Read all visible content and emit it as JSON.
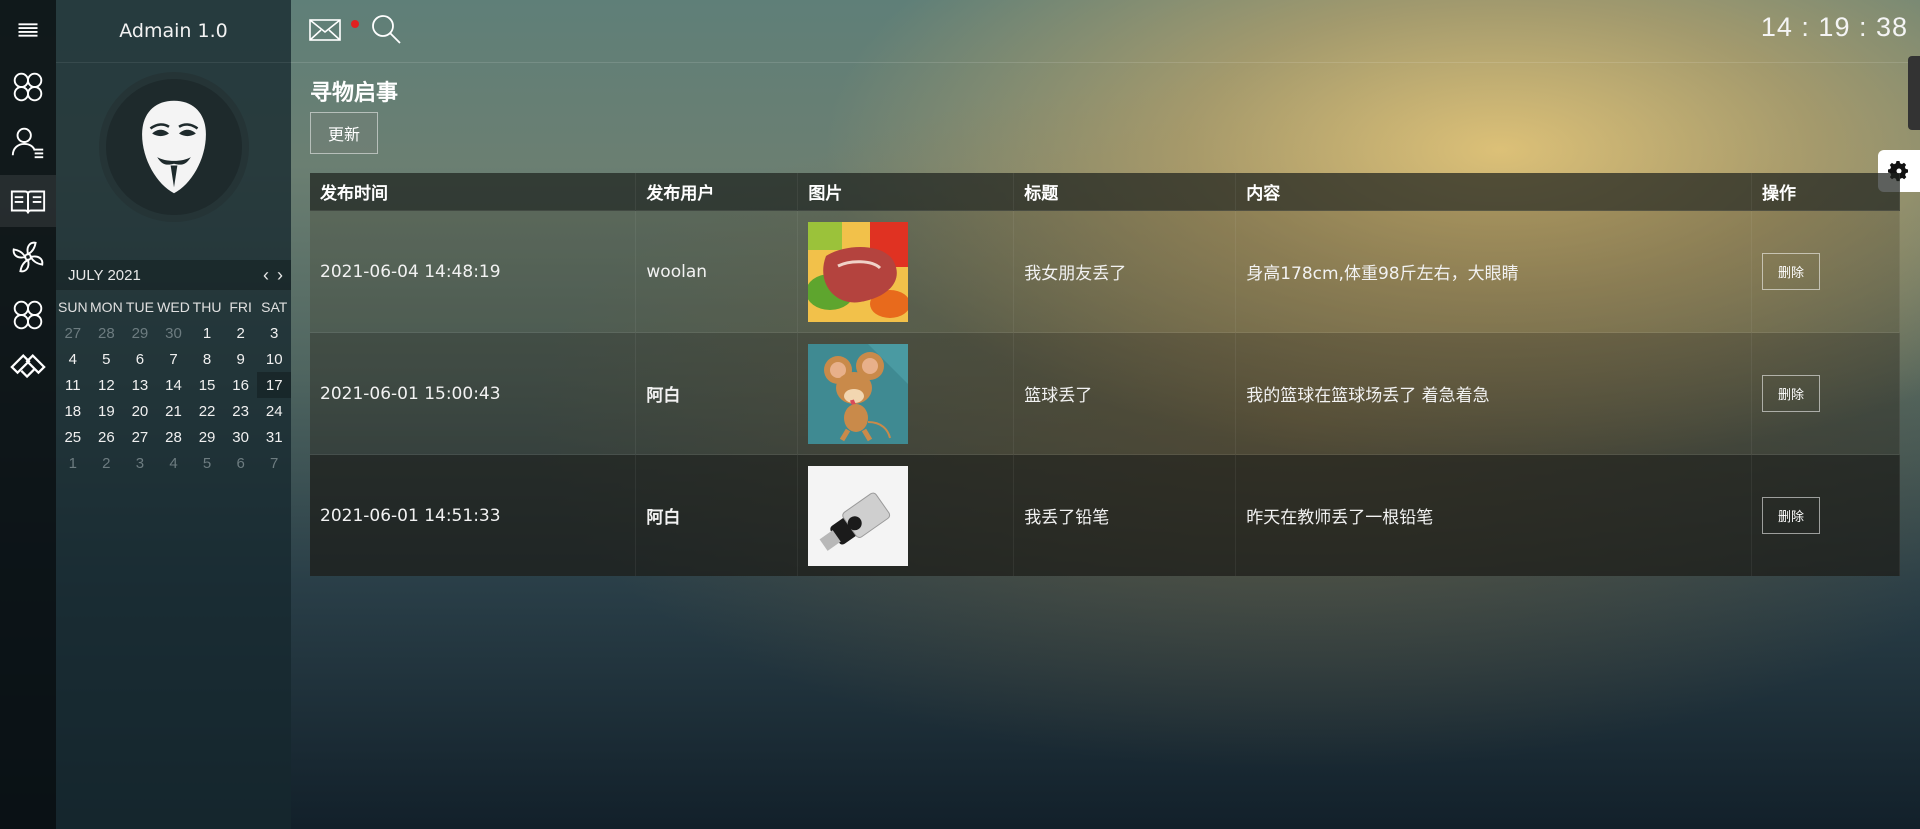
{
  "app": {
    "title": "Admain 1.0",
    "clock": "14 : 19 : 38"
  },
  "iconbar": {
    "items": [
      {
        "icon": "menu-icon"
      },
      {
        "icon": "grid-icon"
      },
      {
        "icon": "user-list-icon"
      },
      {
        "icon": "book-icon",
        "active": true
      },
      {
        "icon": "fan-icon"
      },
      {
        "icon": "grid-icon"
      },
      {
        "icon": "handshake-icon"
      }
    ]
  },
  "topbar": {
    "icons": [
      "mail-icon",
      "search-icon"
    ],
    "mail_has_notification": true
  },
  "calendar": {
    "month_label": "JULY 2021",
    "weekdays": [
      "SUN",
      "MON",
      "TUE",
      "WED",
      "THU",
      "FRI",
      "SAT"
    ],
    "weeks": [
      [
        "27",
        "28",
        "29",
        "30",
        "1",
        "2",
        "3"
      ],
      [
        "4",
        "5",
        "6",
        "7",
        "8",
        "9",
        "10"
      ],
      [
        "11",
        "12",
        "13",
        "14",
        "15",
        "16",
        "17"
      ],
      [
        "18",
        "19",
        "20",
        "21",
        "22",
        "23",
        "24"
      ],
      [
        "25",
        "26",
        "27",
        "28",
        "29",
        "30",
        "31"
      ],
      [
        "1",
        "2",
        "3",
        "4",
        "5",
        "6",
        "7"
      ]
    ],
    "today": "17"
  },
  "page": {
    "title": "寻物启事",
    "update_label": "更新"
  },
  "table": {
    "headers": [
      "发布时间",
      "发布用户",
      "图片",
      "标题",
      "内容",
      "操作"
    ],
    "delete_label": "删除",
    "rows": [
      {
        "time": "2021-06-04 14:48:19",
        "user": "woolan",
        "image": "steak-vegetables-photo",
        "title": "我女朋友丢了",
        "content": "身高178cm,体重98斤左右，大眼睛"
      },
      {
        "time": "2021-06-01 15:00:43",
        "user": "阿白",
        "image": "cartoon-mouse-image",
        "title": "篮球丢了",
        "content": "我的篮球在篮球场丢了 着急着急"
      },
      {
        "time": "2021-06-01 14:51:33",
        "user": "阿白",
        "image": "usb-drive-photo",
        "title": "我丢了铅笔",
        "content": "昨天在教师丢了一根铅笔"
      }
    ]
  },
  "colors": {
    "accent_red": "#e02020",
    "sidebar_bg": "#16282e"
  }
}
